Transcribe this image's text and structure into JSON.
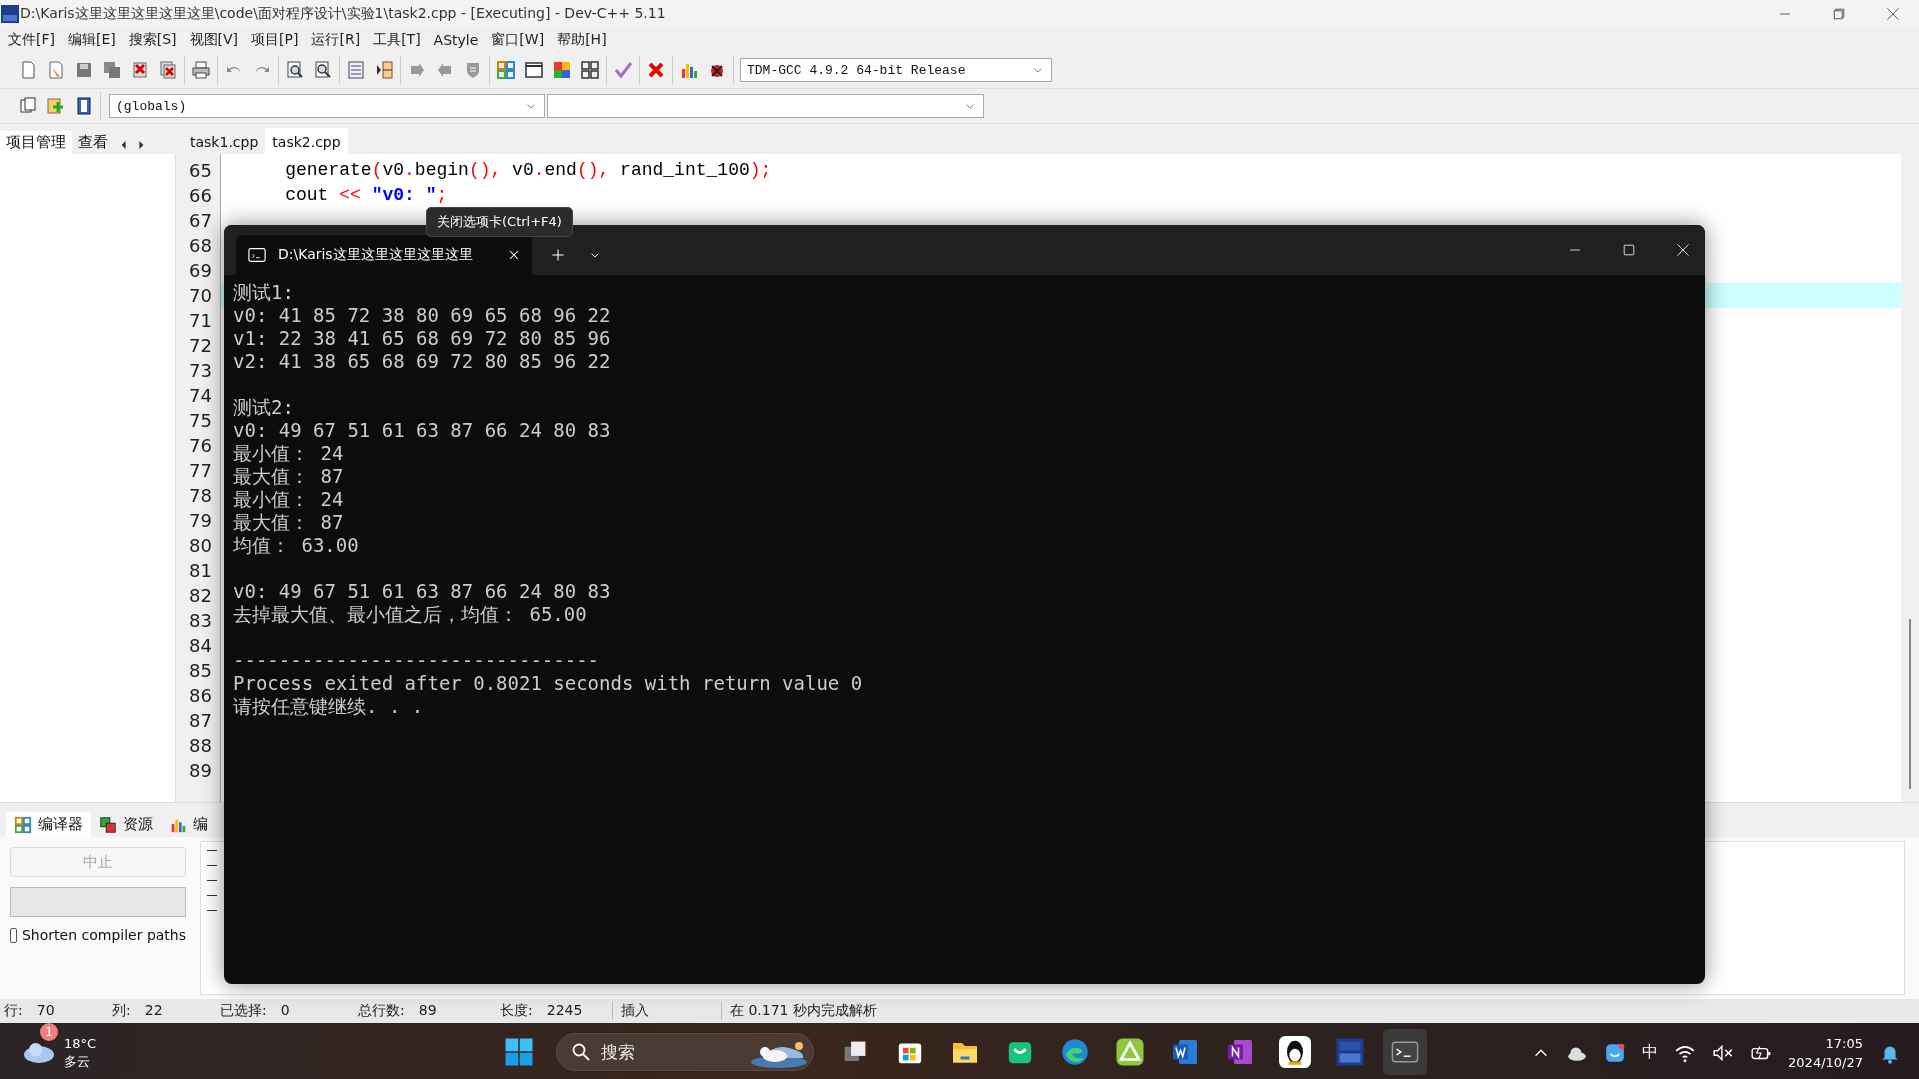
{
  "window": {
    "title": "D:\\Karis这里这里这里这里这里\\code\\面对程序设计\\实验1\\task2.cpp - [Executing] - Dev-C++ 5.11"
  },
  "menu": [
    "文件[F]",
    "编辑[E]",
    "搜索[S]",
    "视图[V]",
    "项目[P]",
    "运行[R]",
    "工具[T]",
    "AStyle",
    "窗口[W]",
    "帮助[H]"
  ],
  "toolbar": {
    "compiler": "TDM-GCC 4.9.2 64-bit Release",
    "scope": "(globals)"
  },
  "side_tabs": [
    {
      "label": "项目管理",
      "selected": true
    },
    {
      "label": "查看",
      "selected": false
    }
  ],
  "editor_tabs": [
    {
      "label": "task1.cpp",
      "selected": false
    },
    {
      "label": "task2.cpp",
      "selected": true
    }
  ],
  "editor": {
    "lines": [
      {
        "number": "65",
        "current": false,
        "tokens": [
          {
            "kind": "plain",
            "text": "    generate"
          },
          {
            "kind": "sym",
            "text": "("
          },
          {
            "kind": "plain",
            "text": "v0"
          },
          {
            "kind": "sym",
            "text": "."
          },
          {
            "kind": "plain",
            "text": "begin"
          },
          {
            "kind": "sym",
            "text": "(),"
          },
          {
            "kind": "plain",
            "text": " v0"
          },
          {
            "kind": "sym",
            "text": "."
          },
          {
            "kind": "plain",
            "text": "end"
          },
          {
            "kind": "sym",
            "text": "(),"
          },
          {
            "kind": "plain",
            "text": " rand_int_100"
          },
          {
            "kind": "sym",
            "text": ");"
          }
        ]
      },
      {
        "number": "66",
        "current": false,
        "tokens": [
          {
            "kind": "plain",
            "text": "    cout "
          },
          {
            "kind": "sym",
            "text": "<<"
          },
          {
            "kind": "str",
            "text": " \"v0: \""
          },
          {
            "kind": "sym",
            "text": ";"
          }
        ]
      },
      {
        "number": "67",
        "current": false
      },
      {
        "number": "68",
        "current": false
      },
      {
        "number": "69",
        "current": false
      },
      {
        "number": "70",
        "current": true
      },
      {
        "number": "71",
        "current": false
      },
      {
        "number": "72",
        "current": false
      },
      {
        "number": "73",
        "current": false
      },
      {
        "number": "74",
        "current": false
      },
      {
        "number": "75",
        "current": false
      },
      {
        "number": "76",
        "current": false
      },
      {
        "number": "77",
        "current": false
      },
      {
        "number": "78",
        "current": false
      },
      {
        "number": "79",
        "current": false
      },
      {
        "number": "80",
        "current": false
      },
      {
        "number": "81",
        "current": false
      },
      {
        "number": "82",
        "current": false
      },
      {
        "number": "83",
        "current": false
      },
      {
        "number": "84",
        "current": false
      },
      {
        "number": "85",
        "current": false
      },
      {
        "number": "86",
        "current": false
      },
      {
        "number": "87",
        "current": false
      },
      {
        "number": "88",
        "current": false
      },
      {
        "number": "89",
        "current": false
      }
    ]
  },
  "tooltip": "关闭选项卡(Ctrl+F4)",
  "console": {
    "tab_title": "D:\\Karis这里这里这里这里这里",
    "blocks": [
      [
        "测试1:",
        "v0: 41 85 72 38 80 69 65 68 96 22",
        "v1: 22 38 41 65 68 69 72 80 85 96",
        "v2: 41 38 65 68 69 72 80 85 96 22"
      ],
      [
        "测试2:",
        "v0: 49 67 51 61 63 87 66 24 80 83",
        "最小值： 24",
        "最大值： 87",
        "最小值： 24",
        "最大值： 87",
        "均值： 63.00"
      ],
      [
        "v0: 49 67 51 61 63 87 66 24 80 83",
        "去掉最大值、最小值之后，均值： 65.00"
      ],
      [
        "--------------------------------",
        "Process exited after 0.8021 seconds with return value 0",
        "请按任意键继续. . ."
      ]
    ]
  },
  "bottom_panel": {
    "tabs": [
      {
        "label": "编译器",
        "selected": true
      },
      {
        "label": "资源",
        "selected": false
      },
      {
        "label": "编",
        "selected": false
      }
    ],
    "abort_button": {
      "label": "中止",
      "disabled": true
    },
    "progress": {
      "level": 0
    },
    "shorten_paths": {
      "label": "Shorten compiler paths",
      "checked": false
    }
  },
  "status_bar": [
    {
      "label": "行:",
      "value": "70"
    },
    {
      "label": "列:",
      "value": "22"
    },
    {
      "label": "已选择:",
      "value": "0"
    },
    {
      "label": "总行数:",
      "value": "89"
    },
    {
      "label": "长度:",
      "value": "2245"
    },
    {
      "label": "插入"
    },
    {
      "label": "在 0.171 秒内完成解析"
    }
  ],
  "taskbar": {
    "weather": {
      "badge": "1",
      "temperature": "18°C",
      "condition": "多云"
    },
    "search": "搜索",
    "ime": "中",
    "time": "17:05",
    "date": "2024/10/27"
  }
}
